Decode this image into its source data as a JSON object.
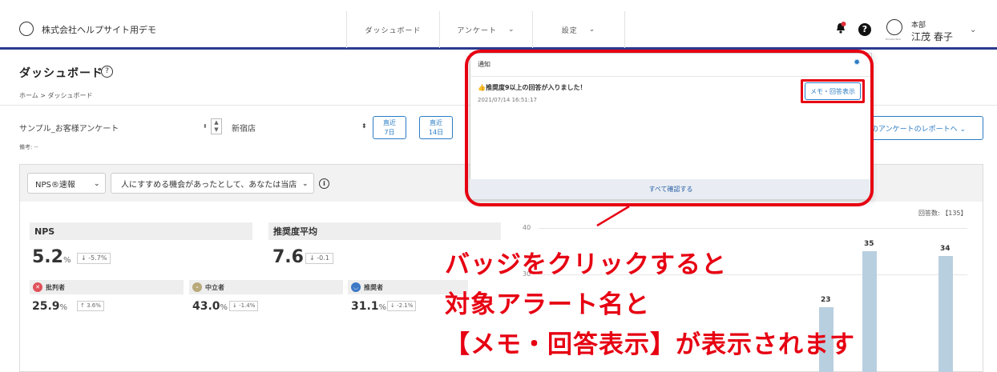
{
  "topbar": {
    "org_name": "株式会社ヘルプサイト用デモ",
    "nav": [
      {
        "label": "ダッシュボード",
        "has_chevron": false
      },
      {
        "label": "アンケート",
        "has_chevron": true
      },
      {
        "label": "設定",
        "has_chevron": true
      }
    ],
    "avatar_sub": "EmotionTech",
    "user_dept": "本部",
    "user_name": "江茂 春子",
    "icons": [
      "bell-icon",
      "help-icon",
      "avatar-icon",
      "chevron-down-icon"
    ]
  },
  "page": {
    "title": "ダッシュボード",
    "title_help": "?",
    "breadcrumb": "ホーム > ダッシュボード"
  },
  "filters": {
    "survey": "サンプル_お客様アンケート",
    "store": "新宿店",
    "periods": [
      {
        "line1": "直近",
        "line2": "7日"
      },
      {
        "line1": "直近",
        "line2": "14日"
      }
    ],
    "note": "備考: --",
    "report_link": "のアンケートのレポートへ ⌄"
  },
  "panel": {
    "metric_select": "NPS®速報",
    "question_select": "人にすすめる機会があったとして、あなたは当店",
    "nps": {
      "label": "NPS",
      "value": "5.2",
      "unit": "%",
      "delta": "↓ -5.7%"
    },
    "avg": {
      "label": "推奨度平均",
      "value": "7.6",
      "delta": "↓ -0.1"
    },
    "segments": [
      {
        "label": "批判者",
        "value": "25.9",
        "unit": "%",
        "delta": "↑ 3.6%",
        "color": "#e0505a"
      },
      {
        "label": "中立者",
        "value": "43.0",
        "unit": "%",
        "delta": "↓ -1.4%",
        "color": "#b9a97a"
      },
      {
        "label": "推奨者",
        "value": "31.1",
        "unit": "%",
        "delta": "↓ -2.1%",
        "color": "#3b78c6"
      }
    ],
    "answer_count": "回答数: 【135】"
  },
  "chart_data": {
    "type": "bar",
    "y_ticks": [
      40,
      30
    ],
    "values": [
      23,
      35,
      34
    ],
    "title": "",
    "xlabel": "",
    "ylabel": ""
  },
  "popup": {
    "title": "通知",
    "alert": "推奨度9以上の回答が入りました！",
    "time": "2021/07/14 16:51:17",
    "memo_button": "メモ・回答表示",
    "footer": "すべて確認する"
  },
  "annotation": {
    "line1": "バッジをクリックすると",
    "line2": "対象アラート名と",
    "line3": "【メモ・回答表示】が表示されます",
    "color": "#e60012"
  }
}
